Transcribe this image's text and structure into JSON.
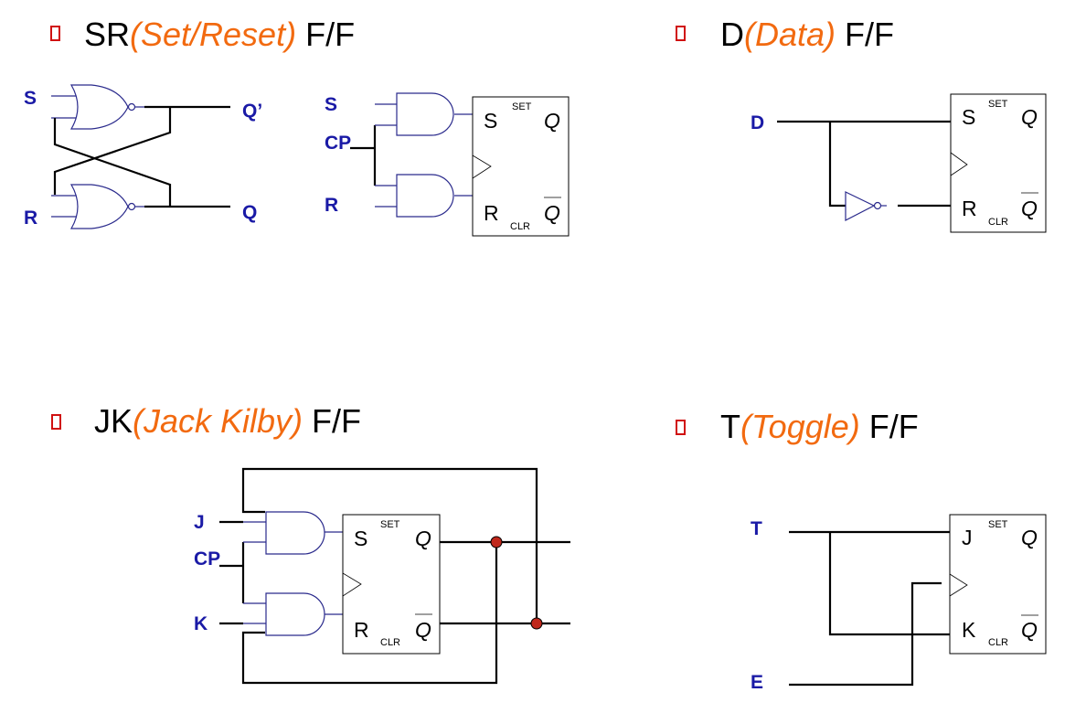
{
  "sections": {
    "sr": {
      "prefix": "SR",
      "paren": "(Set/Reset)",
      "suffix": " F/F",
      "latch": {
        "in_s": "S",
        "in_r": "R",
        "out_qp": "Q’",
        "out_q": "Q"
      },
      "clocked": {
        "in_s": "S",
        "in_cp": "CP",
        "in_r": "R"
      }
    },
    "d": {
      "prefix": "D",
      "paren": "(Data)",
      "suffix": " F/F",
      "in_d": "D"
    },
    "jk": {
      "prefix": "JK",
      "paren": "(Jack Kilby)",
      "suffix": " F/F",
      "in_j": "J",
      "in_cp": "CP",
      "in_k": "K"
    },
    "t": {
      "prefix": "T",
      "paren": "(Toggle)",
      "suffix": " F/F",
      "in_t": "T",
      "in_e": "E"
    }
  },
  "ff_pins": {
    "s": "S",
    "r": "R",
    "j": "J",
    "k": "K",
    "set": "SET",
    "clr": "CLR",
    "q": "Q",
    "qbar": "Q"
  },
  "colors": {
    "title_accent": "#f26a10",
    "input_label": "#1a1aa6",
    "bullet": "#d01010",
    "junction": "#c0281c"
  }
}
